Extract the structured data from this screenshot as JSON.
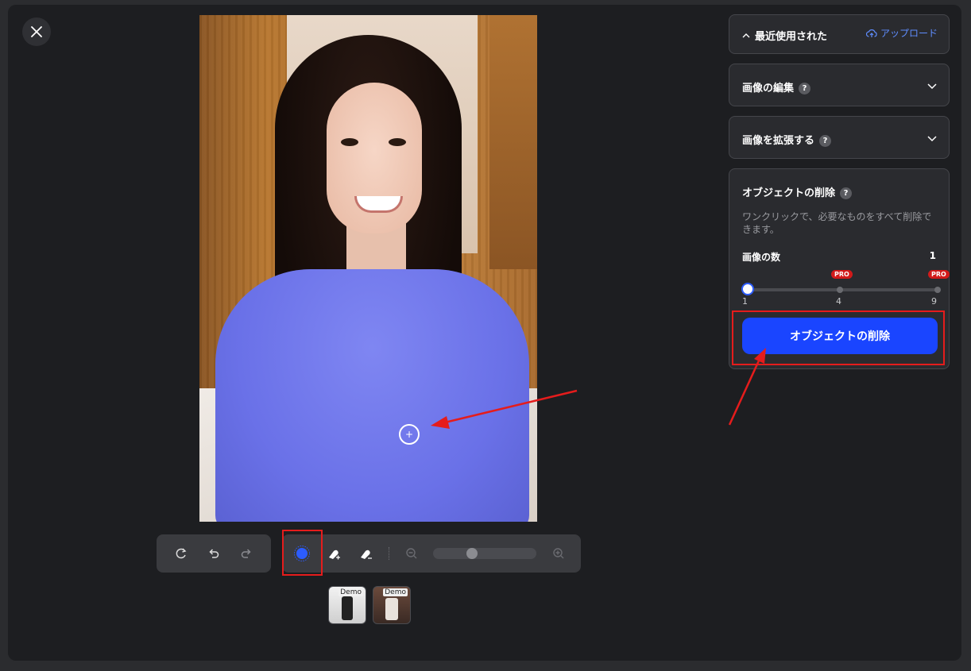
{
  "right_panel": {
    "recent": {
      "title": "最近使用された",
      "upload_label": "アップロード"
    },
    "edit_image": {
      "title": "画像の編集",
      "help": "?"
    },
    "expand_image": {
      "title": "画像を拡張する",
      "help": "?"
    },
    "remove_object": {
      "title": "オブジェクトの削除",
      "help": "?",
      "description": "ワンクリックで、必要なものをすべて削除できます。",
      "image_count_label": "画像の数",
      "image_count_value": "1",
      "slider_ticks": [
        "1",
        "4",
        "9"
      ],
      "pro_badges": [
        "PRO",
        "PRO"
      ],
      "button_label": "オブジェクトの削除"
    }
  },
  "thumbnails": [
    {
      "label": "Demo"
    },
    {
      "label": "Demo"
    }
  ],
  "colors": {
    "accent": "#1a45ff",
    "highlight": "#e51c1c",
    "pro": "#d21a1a"
  },
  "icons": {
    "close": "close-icon",
    "rotate": "rotate-icon",
    "undo": "undo-icon",
    "redo": "redo-icon",
    "smart_select": "smart-select-icon",
    "brush_add": "brush-add-icon",
    "brush_remove": "brush-remove-icon",
    "zoom_out": "zoom-out-icon",
    "zoom_in": "zoom-in-icon"
  }
}
